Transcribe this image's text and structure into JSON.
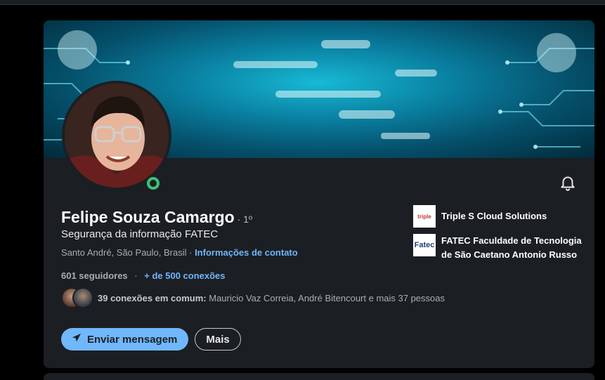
{
  "profile": {
    "name": "Felipe Souza Camargo",
    "degree": "· 1º",
    "headline": "Segurança da informação FATEC",
    "location": "Santo André, São Paulo, Brasil · ",
    "contact_info_label": "Informações de contato",
    "followers": "601 seguidores",
    "separator": "·",
    "connections": "+ de 500 conexões",
    "mutual_connections_bold": "39 conexões em comum:",
    "mutual_connections_names": " Mauricio Vaz Correia, André Bitencourt e mais 37 pessoas",
    "status": "online"
  },
  "actions": {
    "message_label": "Enviar mensagem",
    "more_label": "Mais"
  },
  "experience": [
    {
      "logo_text": "triple",
      "name": "Triple S Cloud Solutions"
    },
    {
      "logo_text": "Fatec",
      "name": "FATEC Faculdade de Tecnologia de São Caetano Antonio Russo"
    }
  ],
  "icons": {
    "bell": "bell-icon",
    "send": "send-icon"
  },
  "colors": {
    "accent": "#71b7fb",
    "link": "#70b5f9",
    "online": "#3ec07a",
    "card_bg": "#1b1f23"
  }
}
